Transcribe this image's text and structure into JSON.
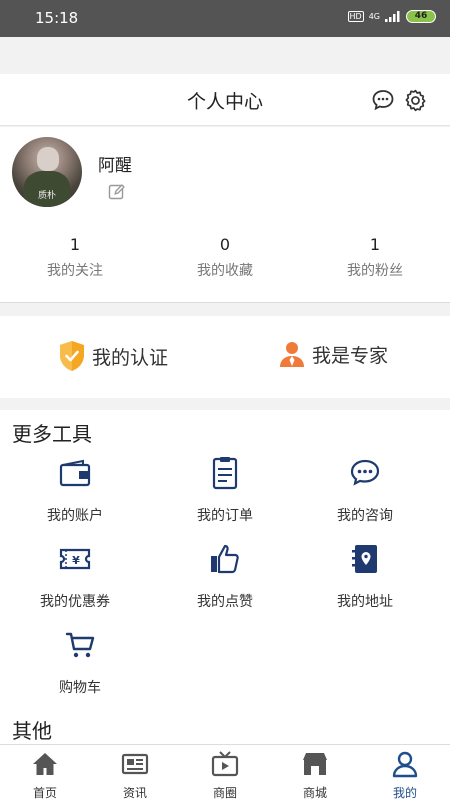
{
  "status_bar": {
    "time": "15:18",
    "hd": "HD",
    "network": "4G",
    "battery": "46"
  },
  "header": {
    "title": "个人中心",
    "chat_icon": "chat-bubble-icon",
    "settings_icon": "gear-icon"
  },
  "profile": {
    "username": "阿醒",
    "avatar_watermark": "质朴",
    "stats": [
      {
        "value": "1",
        "label": "我的关注"
      },
      {
        "value": "0",
        "label": "我的收藏"
      },
      {
        "value": "1",
        "label": "我的粉丝"
      }
    ]
  },
  "certification": {
    "verify_label": "我的认证",
    "expert_label": "我是专家",
    "colors": {
      "orange": "#f5a623",
      "expert": "#f07a3a"
    }
  },
  "tools": {
    "title": "更多工具",
    "items": [
      {
        "label": "我的账户",
        "icon": "wallet-icon"
      },
      {
        "label": "我的订单",
        "icon": "clipboard-icon"
      },
      {
        "label": "我的咨询",
        "icon": "chat-icon"
      },
      {
        "label": "我的优惠券",
        "icon": "coupon-icon"
      },
      {
        "label": "我的点赞",
        "icon": "thumbs-up-icon"
      },
      {
        "label": "我的地址",
        "icon": "address-book-icon"
      },
      {
        "label": "购物车",
        "icon": "cart-icon"
      }
    ]
  },
  "other": {
    "title": "其他"
  },
  "tabbar": {
    "items": [
      {
        "label": "首页",
        "icon": "home-icon"
      },
      {
        "label": "资讯",
        "icon": "newspaper-icon"
      },
      {
        "label": "商圈",
        "icon": "tv-icon"
      },
      {
        "label": "商城",
        "icon": "store-icon"
      },
      {
        "label": "我的",
        "icon": "user-icon"
      }
    ],
    "active_color": "#1f4e8c"
  }
}
